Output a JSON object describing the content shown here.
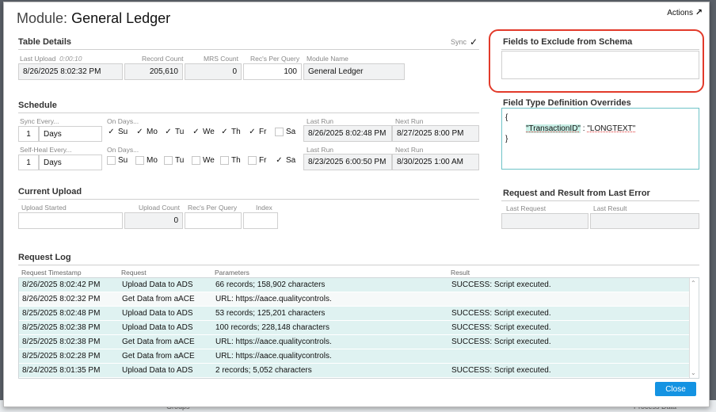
{
  "background": {
    "left_text": "",
    "mid_text": "Groups",
    "right_text": "Process Data"
  },
  "header": {
    "title_prefix": "Module:",
    "title": "General Ledger",
    "actions_label": "Actions",
    "actions_icon": "expand-arrow-icon"
  },
  "table_details": {
    "heading": "Table Details",
    "sync_label": "Sync",
    "sync_checked": true,
    "last_upload_label": "Last Upload",
    "last_upload_duration": "0:00:10",
    "last_upload": "8/26/2025 8:02:32 PM",
    "record_count_label": "Record Count",
    "record_count": "205,610",
    "mrs_count_label": "MRS Count",
    "mrs_count": "0",
    "recs_per_query_label": "Rec's Per Query",
    "recs_per_query": "100",
    "module_name_label": "Module Name",
    "module_name": "General Ledger"
  },
  "schedule": {
    "heading": "Schedule",
    "sync_every_label": "Sync Every...",
    "sync_every_num": "1",
    "sync_every_unit": "Days",
    "on_days_label": "On Days...",
    "days": [
      "Su",
      "Mo",
      "Tu",
      "We",
      "Th",
      "Fr",
      "Sa"
    ],
    "sync_days_checked": [
      true,
      true,
      true,
      true,
      true,
      true,
      false
    ],
    "last_run_label": "Last Run",
    "next_run_label": "Next Run",
    "sync_last_run": "8/26/2025 8:02:48 PM",
    "sync_next_run": "8/27/2025 8:00 PM",
    "self_heal_label": "Self-Heal Every...",
    "self_heal_num": "1",
    "self_heal_unit": "Days",
    "heal_days_checked": [
      false,
      false,
      false,
      false,
      false,
      false,
      true
    ],
    "heal_last_run": "8/23/2025 6:00:50 PM",
    "heal_next_run": "8/30/2025 1:00 AM"
  },
  "current_upload": {
    "heading": "Current Upload",
    "upload_started_label": "Upload Started",
    "upload_started": "",
    "upload_count_label": "Upload Count",
    "upload_count": "0",
    "recs_per_query_label": "Rec's Per Query",
    "recs_per_query": "",
    "index_label": "Index",
    "index": ""
  },
  "exclude": {
    "heading": "Fields to Exclude from Schema",
    "value": ""
  },
  "overrides": {
    "heading": "Field Type Definition Overrides",
    "open_brace": "{",
    "key": "\"TransactionID\"",
    "sep": " : ",
    "value": "\"LONGTEXT\"",
    "close_brace": "}"
  },
  "last_error": {
    "heading": "Request and Result from Last Error",
    "last_request_label": "Last Request",
    "last_result_label": "Last Result",
    "last_request": "",
    "last_result": ""
  },
  "request_log": {
    "heading": "Request Log",
    "columns": [
      "Request Timestamp",
      "Request",
      "Parameters",
      "Result"
    ],
    "rows": [
      [
        "8/26/2025 8:02:42 PM",
        "Upload Data to ADS",
        "66 records; 158,902 characters",
        "SUCCESS: Script executed."
      ],
      [
        "8/26/2025 8:02:32 PM",
        "Get Data from aACE",
        "URL: https://aace.qualitycontrols.",
        ""
      ],
      [
        "8/25/2025 8:02:48 PM",
        "Upload Data to ADS",
        "53 records; 125,201 characters",
        "SUCCESS: Script executed."
      ],
      [
        "8/25/2025 8:02:38 PM",
        "Upload Data to ADS",
        "100 records; 228,148 characters",
        "SUCCESS: Script executed."
      ],
      [
        "8/25/2025 8:02:38 PM",
        "Get Data from aACE",
        "URL: https://aace.qualitycontrols.",
        "SUCCESS: Script executed."
      ],
      [
        "8/25/2025 8:02:28 PM",
        "Get Data from aACE",
        "URL: https://aace.qualitycontrols.",
        ""
      ],
      [
        "8/24/2025 8:01:35 PM",
        "Upload Data to ADS",
        "2 records; 5,052 characters",
        "SUCCESS: Script executed."
      ]
    ]
  },
  "footer": {
    "close_label": "Close"
  },
  "colors": {
    "accent": "#1493e2",
    "highlight_red": "#e23a2a",
    "row_teal": "#dff2f1"
  }
}
